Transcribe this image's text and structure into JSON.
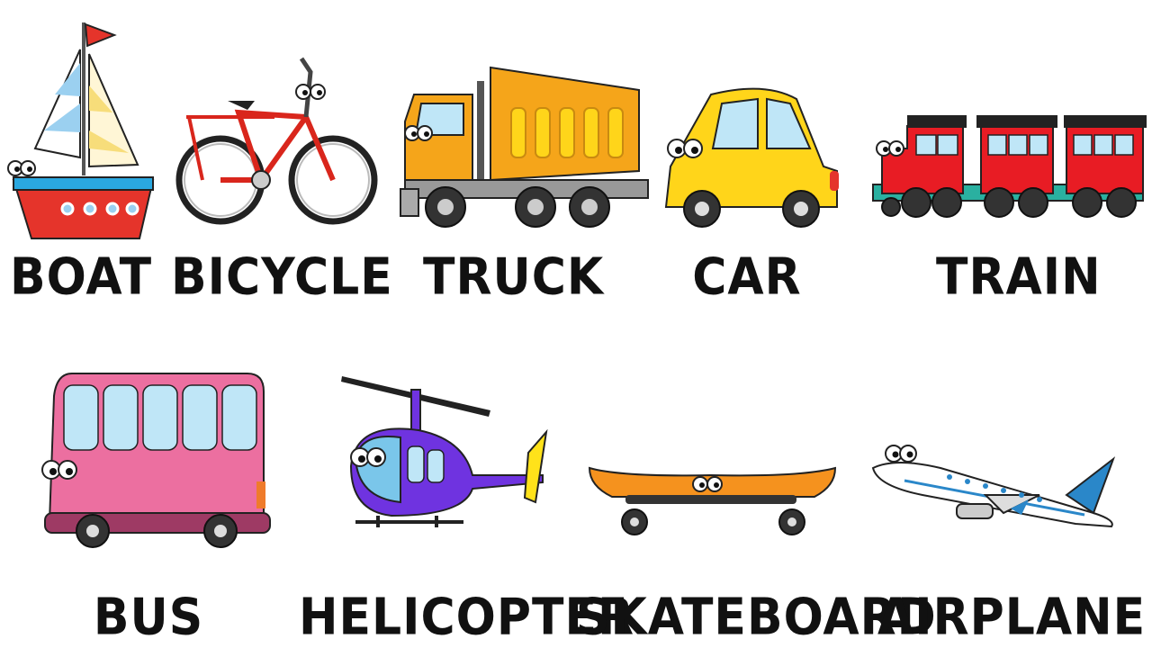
{
  "vehicles": [
    {
      "id": "boat",
      "label": "BOAT",
      "icon": "boat-icon",
      "color": "#e5342b"
    },
    {
      "id": "bicycle",
      "label": "BICYCLE",
      "icon": "bicycle-icon",
      "color": "#d9261c"
    },
    {
      "id": "truck",
      "label": "TRUCK",
      "icon": "truck-icon",
      "color": "#f5a51a"
    },
    {
      "id": "car",
      "label": "CAR",
      "icon": "car-icon",
      "color": "#ffd51a"
    },
    {
      "id": "train",
      "label": "TRAIN",
      "icon": "train-icon",
      "color": "#e81c24"
    },
    {
      "id": "bus",
      "label": "BUS",
      "icon": "bus-icon",
      "color": "#ec6fa0"
    },
    {
      "id": "helicopter",
      "label": "HELICOPTER",
      "icon": "helicopter-icon",
      "color": "#6f33e0"
    },
    {
      "id": "skateboard",
      "label": "SKATEBOARD",
      "icon": "skateboard-icon",
      "color": "#f5921e"
    },
    {
      "id": "airplane",
      "label": "AIRPLANE",
      "icon": "airplane-icon",
      "color": "#2a87c9"
    }
  ]
}
